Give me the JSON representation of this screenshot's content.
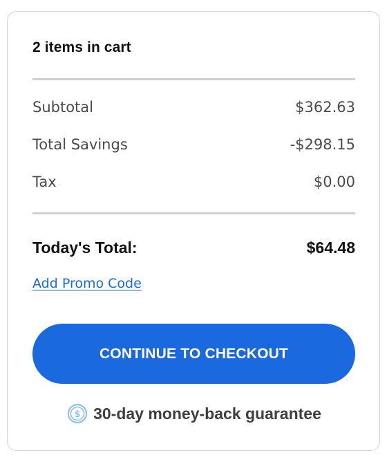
{
  "cart": {
    "items_count_label": "2 items in cart"
  },
  "summary": {
    "lines": [
      {
        "label": "Subtotal",
        "value": "$362.63"
      },
      {
        "label": "Total Savings",
        "value": "-$298.15"
      },
      {
        "label": "Tax",
        "value": "$0.00"
      }
    ],
    "total_label": "Today's Total:",
    "total_value": "$64.48"
  },
  "promo": {
    "link_label": "Add Promo Code"
  },
  "checkout": {
    "button_label": "CONTINUE TO CHECKOUT",
    "color": "#1b69de"
  },
  "guarantee": {
    "icon": "dollar-circle-icon",
    "text": "30-day money-back guarantee"
  }
}
